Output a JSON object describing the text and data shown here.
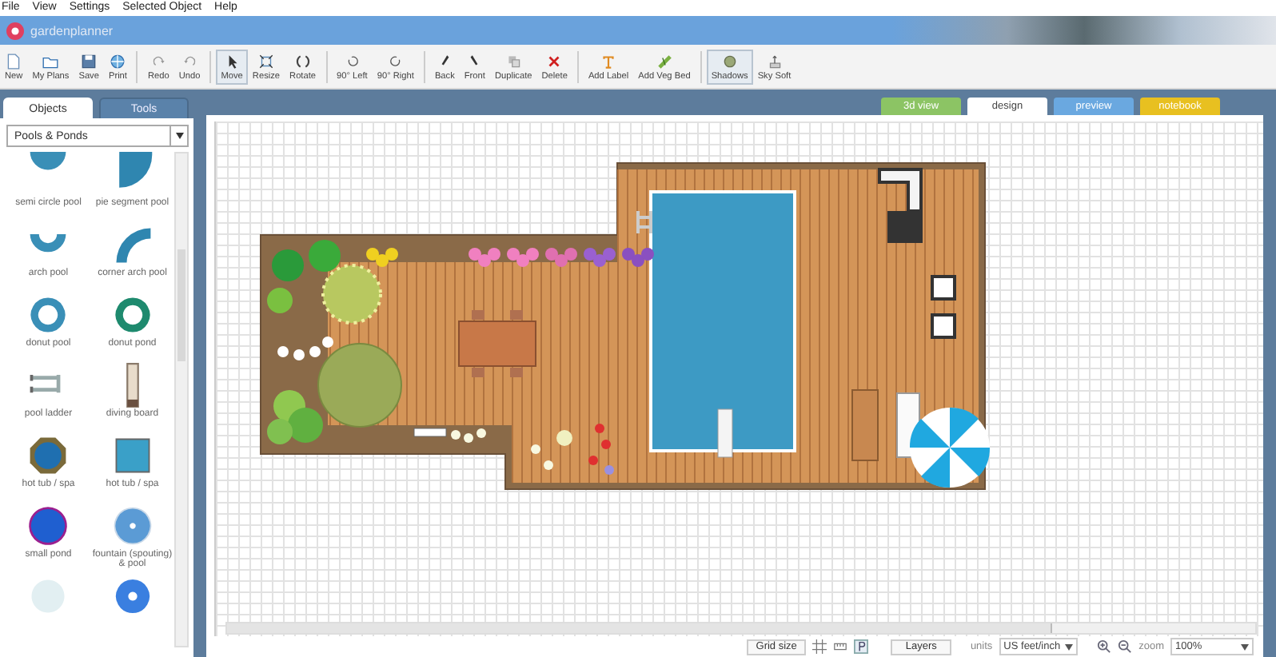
{
  "menu": [
    "File",
    "View",
    "Settings",
    "Selected Object",
    "Help"
  ],
  "app_title": "gardenplanner",
  "toolbar": [
    [
      {
        "label": "New",
        "selected": false
      },
      {
        "label": "My Plans",
        "selected": false
      },
      {
        "label": "Save",
        "selected": false
      },
      {
        "label": "Print",
        "selected": false
      }
    ],
    [
      {
        "label": "Redo",
        "selected": false
      },
      {
        "label": "Undo",
        "selected": false
      }
    ],
    [
      {
        "label": "Move",
        "selected": true
      },
      {
        "label": "Resize",
        "selected": false
      },
      {
        "label": "Rotate",
        "selected": false
      }
    ],
    [
      {
        "label": "90° Left",
        "selected": false
      },
      {
        "label": "90° Right",
        "selected": false
      }
    ],
    [
      {
        "label": "Back",
        "selected": false
      },
      {
        "label": "Front",
        "selected": false
      },
      {
        "label": "Duplicate",
        "selected": false
      },
      {
        "label": "Delete",
        "selected": false
      }
    ],
    [
      {
        "label": "Add Label",
        "selected": false
      },
      {
        "label": "Add Veg Bed",
        "selected": false
      }
    ],
    [
      {
        "label": "Shadows",
        "selected": true
      },
      {
        "label": "Sky Soft",
        "selected": false
      }
    ]
  ],
  "sidebar": {
    "tabs": [
      {
        "label": "Objects",
        "selected": true
      },
      {
        "label": "Tools",
        "selected": false
      }
    ],
    "category": "Pools & Ponds",
    "objects": [
      {
        "kind": "semi-circle",
        "label": "semi circle pool"
      },
      {
        "kind": "pie",
        "label": "pie segment pool"
      },
      {
        "kind": "arch",
        "label": "arch pool"
      },
      {
        "kind": "corner-arch",
        "label": "corner arch pool"
      },
      {
        "kind": "donut-pool",
        "label": "donut pool"
      },
      {
        "kind": "donut-pond",
        "label": "donut pond"
      },
      {
        "kind": "ladder",
        "label": "pool ladder"
      },
      {
        "kind": "board",
        "label": "diving board"
      },
      {
        "kind": "octagon-tub",
        "label": "hot tub / spa"
      },
      {
        "kind": "square-tub",
        "label": "hot tub / spa"
      },
      {
        "kind": "small-pond",
        "label": "small pond"
      },
      {
        "kind": "fountain",
        "label": "fountain (spouting) & pool"
      },
      {
        "kind": "shrub"
      },
      {
        "kind": "round-fountain"
      }
    ]
  },
  "view_tabs": [
    {
      "label": "3d view",
      "selected": false,
      "color": "#8cc464"
    },
    {
      "label": "design",
      "selected": true,
      "color": "#ffffff"
    },
    {
      "label": "preview",
      "selected": false,
      "color": "#6aa8e0"
    },
    {
      "label": "notebook",
      "selected": false,
      "color": "#e8c020"
    }
  ],
  "status_bar": {
    "grid_size": "Grid size",
    "layers": "Layers",
    "units_label": "units",
    "units": "US feet/inch",
    "zoom_label": "zoom",
    "zoom": "100%"
  }
}
